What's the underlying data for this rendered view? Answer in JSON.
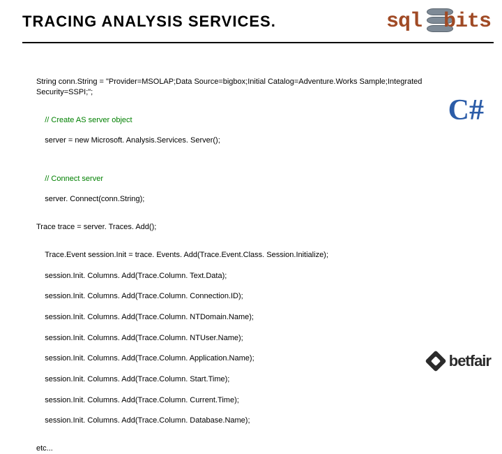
{
  "header": {
    "title": "TRACING ANALYSIS SERVICES.",
    "logo": {
      "left": "sql",
      "right": "bits"
    }
  },
  "lang_badge": "C#",
  "code": {
    "conn": "String conn.String = \"Provider=MSOLAP;Data Source=bigbox;Initial Catalog=Adventure.Works Sample;Integrated Security=SSPI;\";",
    "comment_create": "// Create AS server object",
    "server_new": "server = new Microsoft. Analysis.Services. Server();",
    "comment_connect": "// Connect server",
    "server_connect": "server. Connect(conn.String);",
    "trace_add": "Trace trace = server. Traces. Add();",
    "session_init": "Trace.Event session.Init = trace. Events. Add(Trace.Event.Class. Session.Initialize);",
    "cols": [
      "session.Init. Columns. Add(Trace.Column. Text.Data);",
      "session.Init. Columns. Add(Trace.Column. Connection.ID);",
      "session.Init. Columns. Add(Trace.Column. NTDomain.Name);",
      "session.Init. Columns. Add(Trace.Column. NTUser.Name);",
      "session.Init. Columns. Add(Trace.Column. Application.Name);",
      "session.Init. Columns. Add(Trace.Column. Start.Time);",
      "session.Init. Columns. Add(Trace.Column. Current.Time);",
      "session.Init. Columns. Add(Trace.Column. Database.Name);"
    ],
    "etc": "etc..."
  },
  "footer": {
    "brand": "betfair"
  }
}
